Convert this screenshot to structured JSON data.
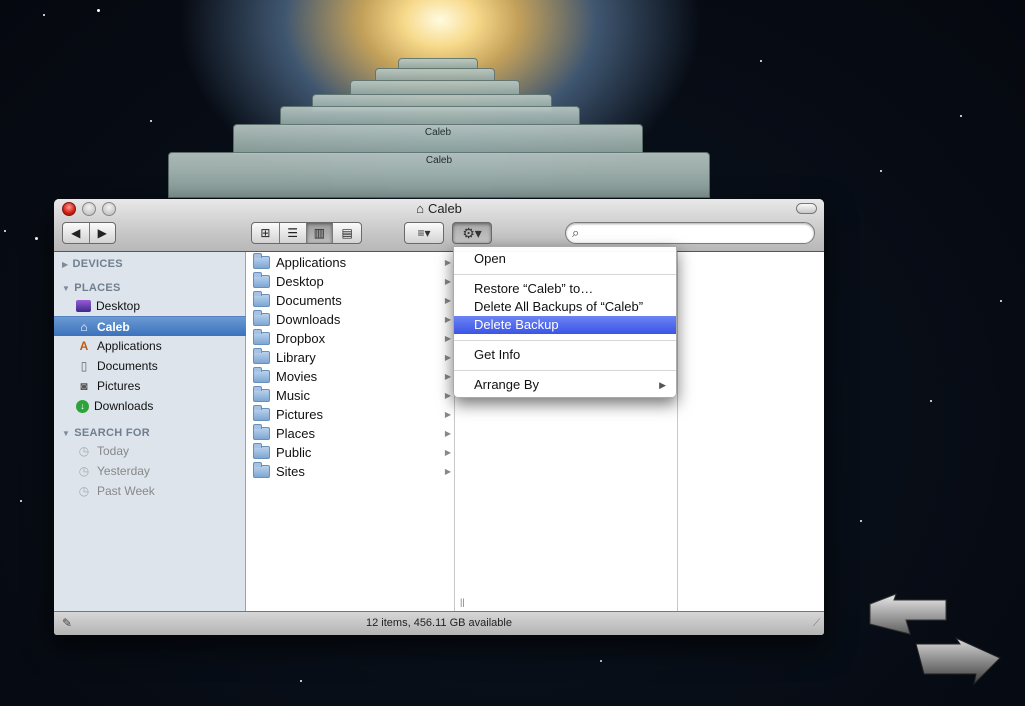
{
  "window": {
    "title": "Caleb"
  },
  "toolbar": {
    "view_buttons": [
      "icon-view",
      "list-view",
      "column-view",
      "coverflow-view"
    ],
    "search": {
      "value": "",
      "placeholder": ""
    }
  },
  "background_windows": {
    "title": "Caleb"
  },
  "sidebar": {
    "devices_header": "DEVICES",
    "places_header": "PLACES",
    "places": [
      {
        "label": "Desktop",
        "icon": "desktop-icon"
      },
      {
        "label": "Caleb",
        "icon": "home-icon"
      },
      {
        "label": "Applications",
        "icon": "applications-icon"
      },
      {
        "label": "Documents",
        "icon": "documents-icon"
      },
      {
        "label": "Pictures",
        "icon": "pictures-icon"
      },
      {
        "label": "Downloads",
        "icon": "downloads-icon"
      }
    ],
    "search_header": "SEARCH FOR",
    "search_for": [
      {
        "label": "Today",
        "icon": "clock-icon"
      },
      {
        "label": "Yesterday",
        "icon": "clock-icon"
      },
      {
        "label": "Past Week",
        "icon": "clock-icon"
      }
    ]
  },
  "column1": {
    "items": [
      "Applications",
      "Desktop",
      "Documents",
      "Downloads",
      "Dropbox",
      "Library",
      "Movies",
      "Music",
      "Pictures",
      "Places",
      "Public",
      "Sites"
    ]
  },
  "context_menu": {
    "open": "Open",
    "restore": "Restore “Caleb” to…",
    "delete_all": "Delete All Backups of “Caleb”",
    "delete_backup": "Delete Backup",
    "get_info": "Get Info",
    "arrange_by": "Arrange By"
  },
  "status": {
    "text": "12 items, 456.11 GB available"
  },
  "colors": {
    "selection": "#3c72bd",
    "menu_highlight": "#3b55e6",
    "sidebar_bg": "#dde4ec"
  }
}
